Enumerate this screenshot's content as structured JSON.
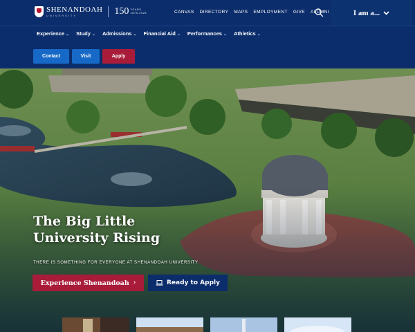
{
  "brand": {
    "name": "SHENANDOAH",
    "subname": "UNIVERSITY",
    "anniversary_number": "150",
    "anniversary_label": "YEARS",
    "anniversary_range": "1875-2025"
  },
  "utility_nav": [
    "CANVAS",
    "DIRECTORY",
    "MAPS",
    "EMPLOYMENT",
    "GIVE",
    "ALUMNI"
  ],
  "audience_menu": {
    "label": "I am a..."
  },
  "main_nav": [
    "Experience",
    "Study",
    "Admissions",
    "Financial Aid",
    "Performances",
    "Athletics"
  ],
  "cta": {
    "contact": "Contact",
    "visit": "Visit",
    "apply": "Apply"
  },
  "hero": {
    "title_line1": "The Big Little",
    "title_line2": "University Rising",
    "subtitle": "THERE IS SOMETHING FOR EVERYONE AT SHENANDOAH UNIVERSITY",
    "primary_button": "Experience Shenandoah",
    "secondary_button": "Ready to Apply"
  },
  "icons": {
    "search": "search-icon",
    "chevron": "chevron-down-icon",
    "arrow": "arrow-right-icon",
    "laptop": "laptop-icon"
  },
  "colors": {
    "navy": "#0b2d6b",
    "blue_button": "#1769c7",
    "crimson": "#a81c3a"
  }
}
